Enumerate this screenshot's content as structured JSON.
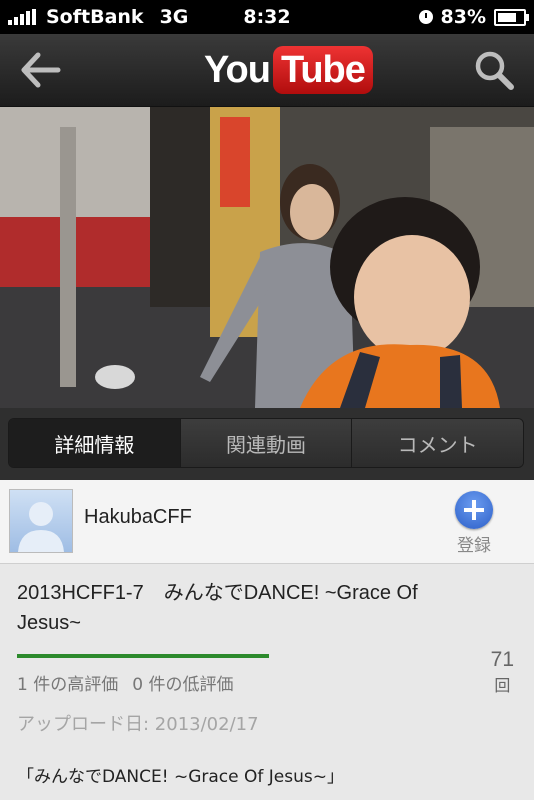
{
  "status_bar": {
    "carrier": "SoftBank",
    "network": "3G",
    "time": "8:32",
    "battery": "83%",
    "battery_level": 0.83
  },
  "nav": {
    "logo_you": "You",
    "logo_tube": "Tube",
    "back_icon": "back-arrow-icon",
    "search_icon": "search-icon"
  },
  "tabs": [
    {
      "label": "詳細情報",
      "active": true
    },
    {
      "label": "関連動画",
      "active": false
    },
    {
      "label": "コメント",
      "active": false
    }
  ],
  "channel": {
    "name": "HakubaCFF",
    "subscribe_label": "登録"
  },
  "video": {
    "title": "2013HCFF1-7　みんなでDANCE! ~Grace Of Jesus~",
    "likes": "1 件の高評価",
    "dislikes": "0 件の低評価",
    "like_ratio": 1.0,
    "views": "71",
    "views_unit": "回",
    "upload_label": "アップロード日: 2013/02/17",
    "description": "「みんなでDANCE! ~Grace Of Jesus~」"
  },
  "colors": {
    "rating_bar": "#2c8a2c",
    "subscribe_button": "#3f74d8",
    "logo_red": "#cc1f1f"
  }
}
